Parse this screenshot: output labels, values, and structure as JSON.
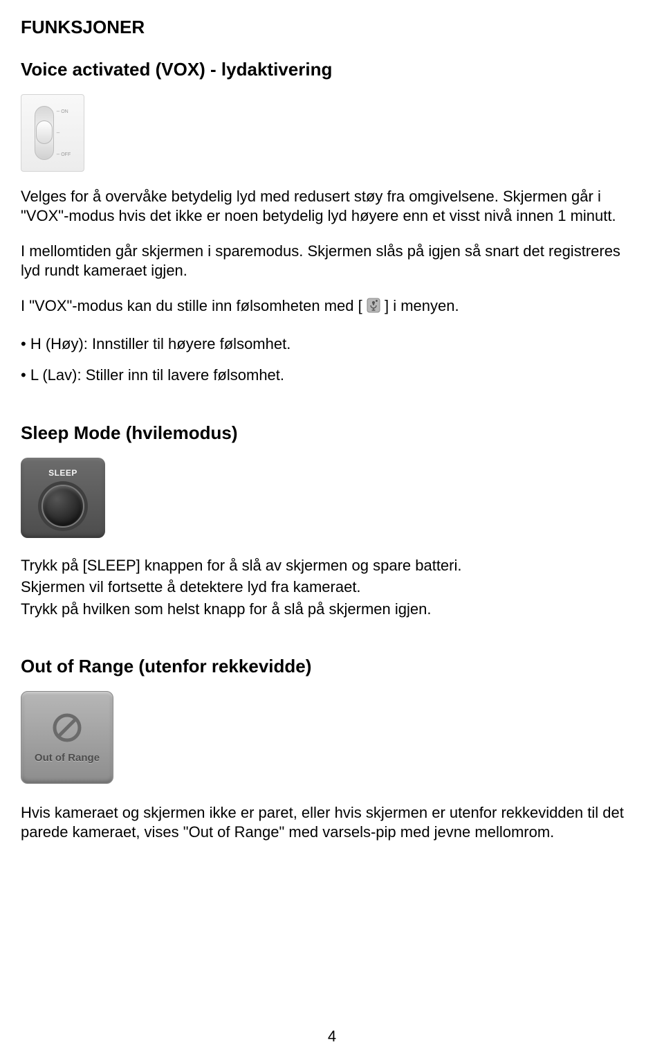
{
  "headings": {
    "funksjoner": "FUNKSJONER",
    "vox": "Voice activated (VOX) - lydaktivering",
    "sleep": "Sleep Mode (hvilemodus)",
    "oor": "Out of Range (utenfor rekkevidde)"
  },
  "vox": {
    "p1": "Velges for å overvåke betydelig lyd med redusert støy fra omgivelsene. Skjermen går i \"VOX\"-modus hvis det ikke er noen betydelig lyd høyere enn et visst nivå innen 1 minutt.",
    "p2": "I mellomtiden går skjermen i sparemodus. Skjermen slås på igjen så snart det registreres lyd rundt kameraet igjen.",
    "p3_before": "I \"VOX\"-modus kan du stille inn følsomheten med [",
    "p3_after": "] i menyen.",
    "bullet1": "• H (Høy): Innstiller til høyere følsomhet.",
    "bullet2": "• L (Lav): Stiller inn til lavere følsomhet.",
    "slider_labels": {
      "top": "ON",
      "mid": "",
      "bot": "OFF"
    }
  },
  "sleep": {
    "btn_label": "SLEEP",
    "p1": "Trykk på [SLEEP] knappen for å slå av skjermen og spare batteri.",
    "p2": "Skjermen vil fortsette å detektere lyd fra kameraet.",
    "p3": "Trykk på hvilken som helst knapp for å slå på skjermen igjen."
  },
  "oor": {
    "label": "Out of Range",
    "p1": "Hvis kameraet og skjermen ikke er paret, eller hvis skjermen er utenfor rekkevidden til det parede kameraet, vises \"Out of Range\" med varsels-pip med jevne mellomrom."
  },
  "page_number": "4"
}
